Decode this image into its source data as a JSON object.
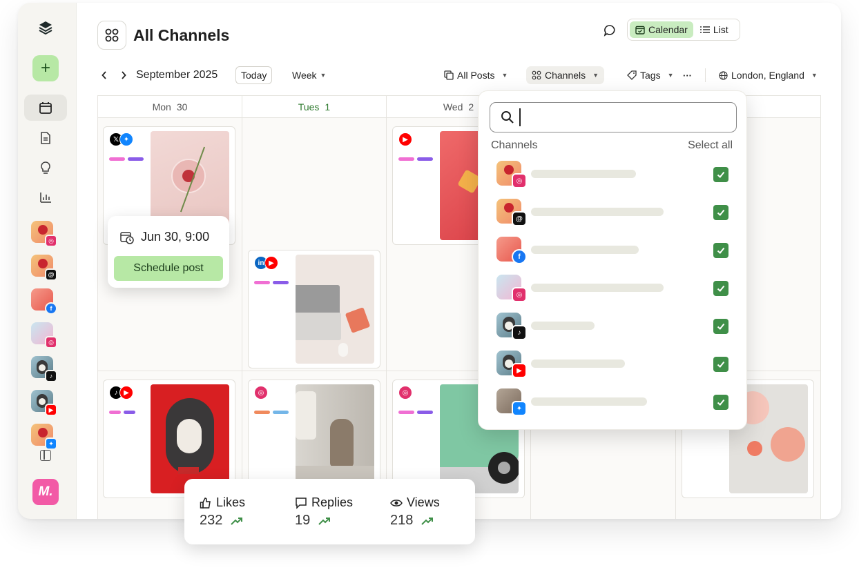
{
  "header": {
    "title": "All Channels",
    "view_calendar": "Calendar",
    "view_list": "List"
  },
  "toolbar": {
    "month": "September 2025",
    "today": "Today",
    "range": "Week",
    "posts_filter": "All Posts",
    "channels_filter": "Channels",
    "tags_filter": "Tags",
    "more": "···",
    "location": "London, England"
  },
  "calendar": {
    "columns": [
      {
        "day": "Mon",
        "date": "30"
      },
      {
        "day": "Tues",
        "date": "1"
      },
      {
        "day": "Wed",
        "date": "2"
      }
    ]
  },
  "schedule_popup": {
    "datetime": "Jun 30, 9:00",
    "button": "Schedule post"
  },
  "channels_dropdown": {
    "label": "Channels",
    "select_all": "Select all",
    "search_placeholder": "",
    "items": [
      {
        "network": "instagram",
        "checked": true
      },
      {
        "network": "threads",
        "checked": true
      },
      {
        "network": "facebook",
        "checked": true
      },
      {
        "network": "instagram",
        "checked": true
      },
      {
        "network": "tiktok",
        "checked": true
      },
      {
        "network": "youtube",
        "checked": true
      },
      {
        "network": "bluesky",
        "checked": true
      }
    ]
  },
  "stats": {
    "likes_label": "Likes",
    "likes_value": "232",
    "replies_label": "Replies",
    "replies_value": "19",
    "views_label": "Views",
    "views_value": "218"
  },
  "colors": {
    "accent_green": "#b7e8a5",
    "check_green": "#3f8f48",
    "today_green": "#2e7a2e",
    "brand_pink": "#f25aa6",
    "instagram": "#e1306c",
    "facebook": "#1877f2",
    "youtube": "#ff0000",
    "tiktok": "#000000",
    "threads": "#000000",
    "bluesky": "#1185fe",
    "linkedin": "#0a66c2",
    "x": "#000000"
  }
}
